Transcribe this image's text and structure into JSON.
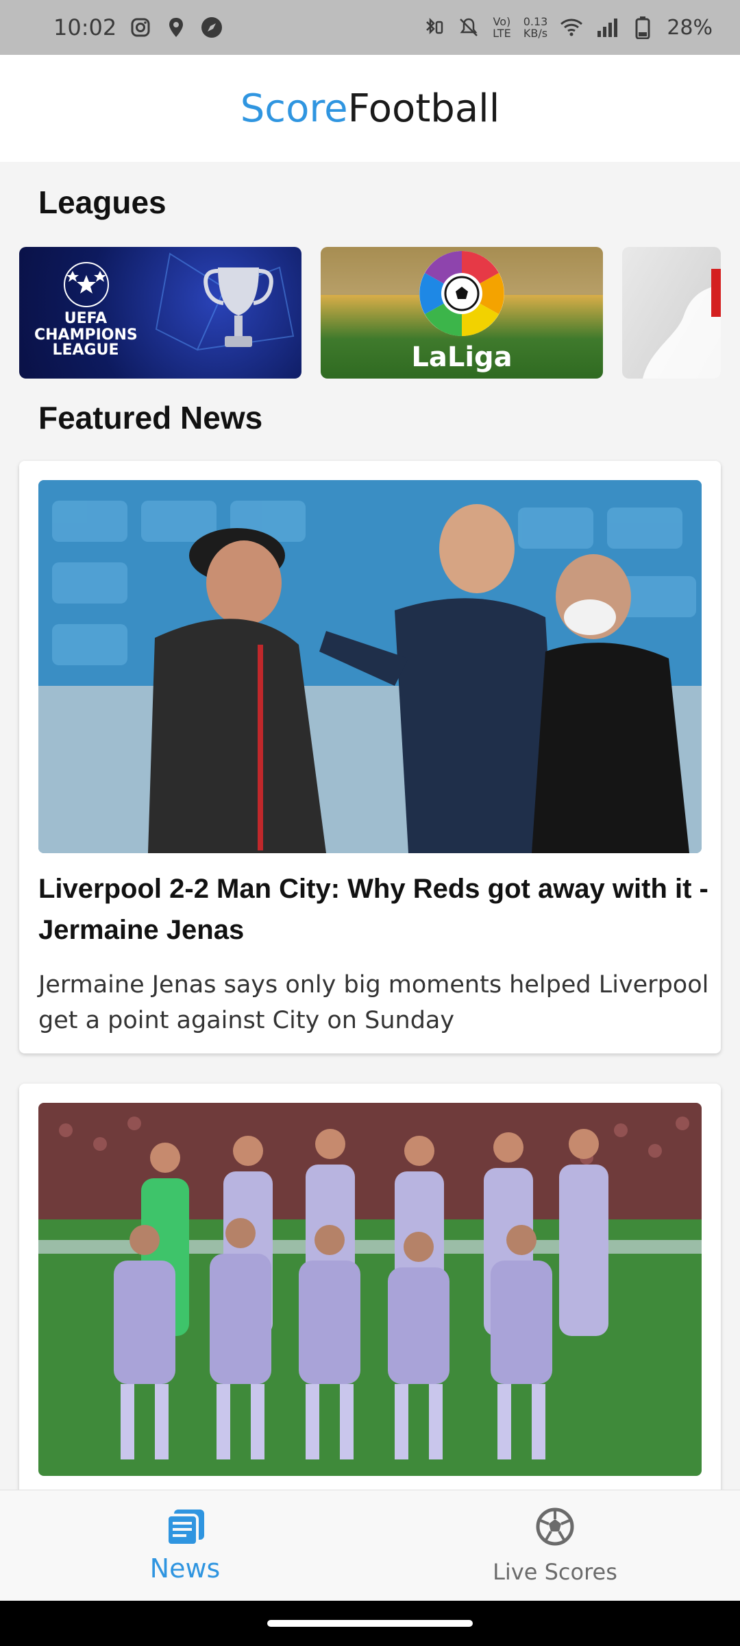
{
  "status_bar": {
    "time": "10:02",
    "net_speed_value": "0.13",
    "net_speed_unit": "KB/s",
    "network_labels": [
      "Vo)",
      "LTE"
    ],
    "battery": "28%",
    "icons": [
      "instagram-icon",
      "location-icon",
      "compass-icon",
      "bluetooth-vibrate-icon",
      "mute-icon",
      "volte-icon",
      "wifi-icon",
      "signal-icon",
      "battery-icon"
    ]
  },
  "app_bar": {
    "brand_part1": "Score",
    "brand_part2": "Football",
    "brand_color": "#2f95e0"
  },
  "leagues": {
    "title": "Leagues",
    "items": [
      {
        "label": "CHAMPIONS LEAGUE",
        "badge": "UEFA",
        "image": "champions-league-banner"
      },
      {
        "label": "LaLiga",
        "image": "laliga-banner"
      },
      {
        "label": "",
        "image": "third-league-banner"
      }
    ]
  },
  "featured_news": {
    "title": "Featured News",
    "articles": [
      {
        "title": "Liverpool 2-2 Man City: Why Reds got away with it - Jermaine Jenas",
        "summary": "Jermaine Jenas says only big moments helped Liverpool get a point against City on Sunday",
        "image": "managers-handshake-photo"
      },
      {
        "title": "",
        "summary": "",
        "image": "team-photo"
      }
    ]
  },
  "bottom_nav": {
    "items": [
      {
        "label": "News",
        "icon": "news-icon",
        "active": true
      },
      {
        "label": "Live Scores",
        "icon": "soccer-ball-icon",
        "active": false
      }
    ],
    "active_color": "#2f95e0"
  }
}
